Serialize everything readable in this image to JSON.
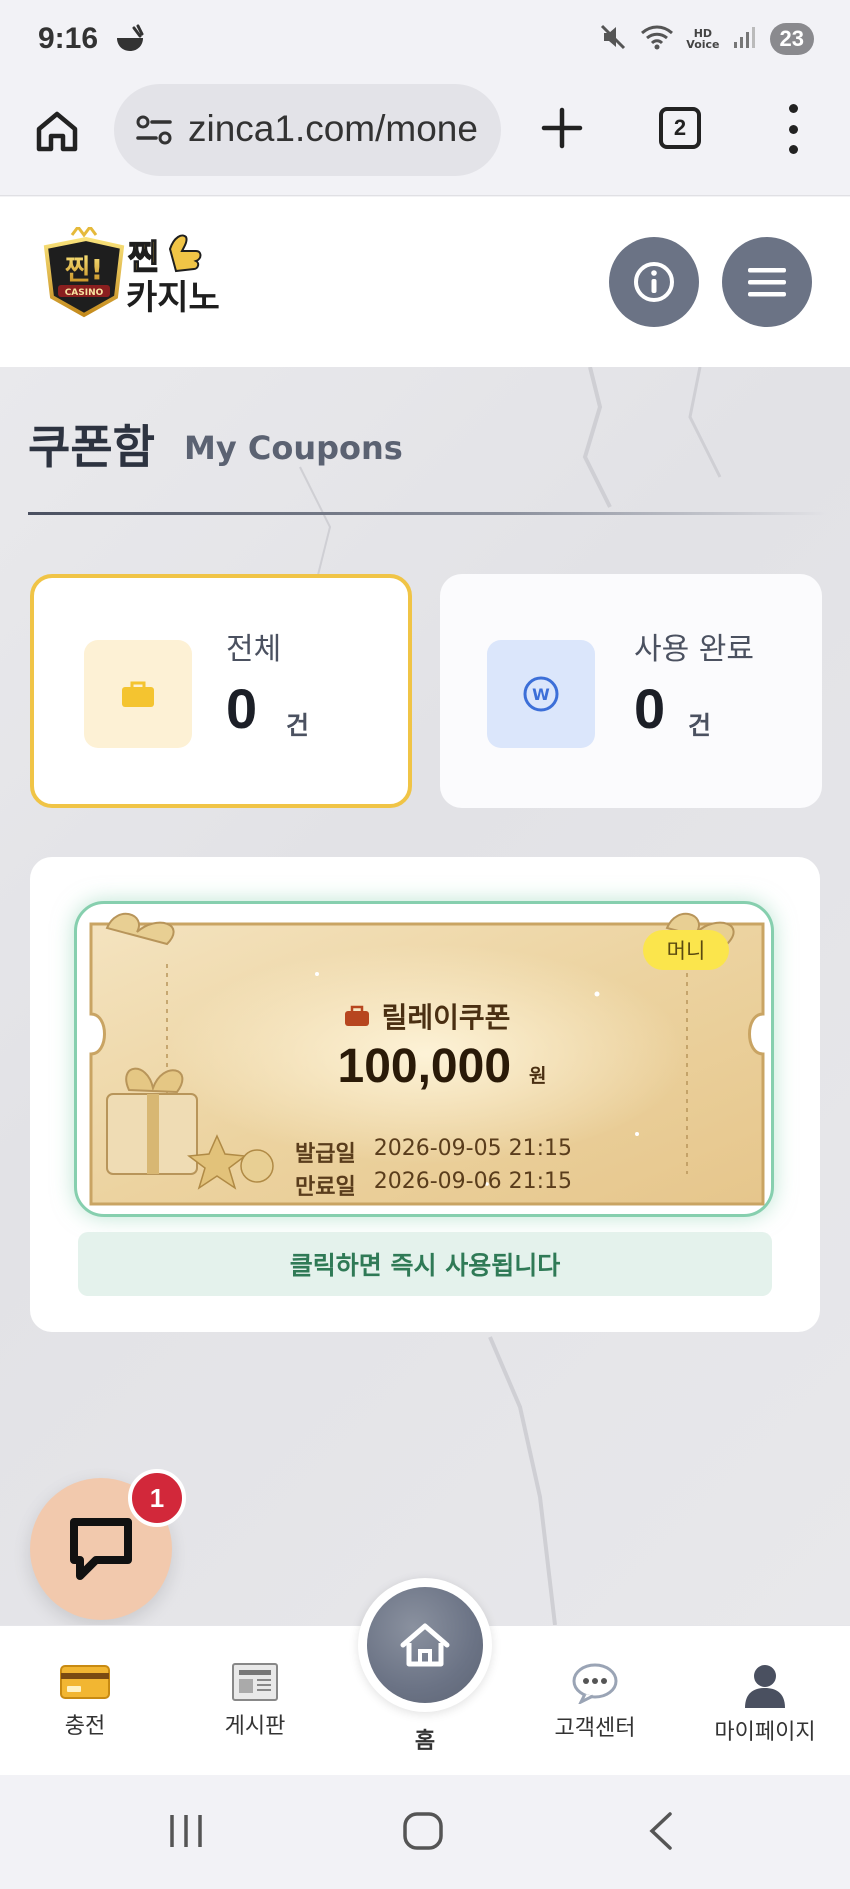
{
  "status_bar": {
    "time": "9:16",
    "battery": "23",
    "hd_label": "HD",
    "voice_label": "Voice"
  },
  "browser": {
    "url": "zinca1.com/mone",
    "tab_count": "2"
  },
  "site": {
    "logo_alt": "찐! CASINO 찐카지노"
  },
  "page": {
    "title": "쿠폰함",
    "subtitle": "My Coupons"
  },
  "stats": [
    {
      "label": "전체",
      "count": "0",
      "unit": "건",
      "icon": "briefcase-icon",
      "color": "#f4c430"
    },
    {
      "label": "사용 완료",
      "count": "0",
      "unit": "건",
      "icon": "won-coin-icon",
      "color": "#3c6fd8"
    }
  ],
  "coupon": {
    "badge": "머니",
    "name": "릴레이쿠폰",
    "amount": "100,000",
    "currency": "원",
    "issued_label": "발급일",
    "issued_date": "2026-09-05 21:15",
    "expiry_label": "만료일",
    "expiry_date": "2026-09-06 21:15",
    "hint": "클릭하면 즉시 사용됩니다"
  },
  "chat": {
    "badge_count": "1"
  },
  "bottom_nav": {
    "charge": "충전",
    "board": "게시판",
    "home": "홈",
    "support": "고객센터",
    "mypage": "마이페이지"
  },
  "colors": {
    "accent_yellow": "#f0c446",
    "accent_green": "#86cfae",
    "slate": "#6b7385"
  }
}
